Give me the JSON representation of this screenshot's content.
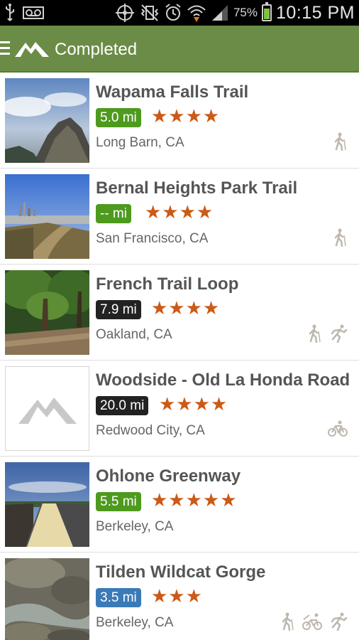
{
  "status_bar": {
    "battery_percent": "75%",
    "time": "10:15 PM"
  },
  "action_bar": {
    "title": "Completed"
  },
  "colors": {
    "action_bar": "#6b8c46",
    "green_badge": "#4e9a1e",
    "black_badge": "#222222",
    "blue_badge": "#3a7ab8",
    "star": "#cc5a16"
  },
  "trails": [
    {
      "name": "Wapama Falls Trail",
      "distance": "5.0 mi",
      "badge_color": "#4e9a1e",
      "stars": "★★★★",
      "location": "Long Barn, CA",
      "activities": [
        "hiking-icon"
      ]
    },
    {
      "name": "Bernal Heights Park Trail",
      "distance": "-- mi",
      "badge_color": "#4e9a1e",
      "stars": "★★★★",
      "location": "San Francisco, CA",
      "activities": [
        "hiking-icon"
      ]
    },
    {
      "name": "French Trail Loop",
      "distance": "7.9 mi",
      "badge_color": "#222222",
      "stars": "★★★★",
      "location": "Oakland, CA",
      "activities": [
        "hiking-icon",
        "running-icon"
      ]
    },
    {
      "name": "Woodside - Old La Honda Road",
      "distance": "20.0 mi",
      "badge_color": "#222222",
      "stars": "★★★★",
      "location": "Redwood City, CA",
      "activities": [
        "biking-icon"
      ]
    },
    {
      "name": "Ohlone Greenway",
      "distance": "5.5 mi",
      "badge_color": "#4e9a1e",
      "stars": "★★★★★",
      "location": "Berkeley, CA",
      "activities": []
    },
    {
      "name": "Tilden Wildcat Gorge",
      "distance": "3.5 mi",
      "badge_color": "#3a7ab8",
      "stars": "★★★",
      "location": "Berkeley, CA",
      "activities": [
        "hiking-icon",
        "mountain-biking-icon",
        "running-icon"
      ]
    }
  ]
}
